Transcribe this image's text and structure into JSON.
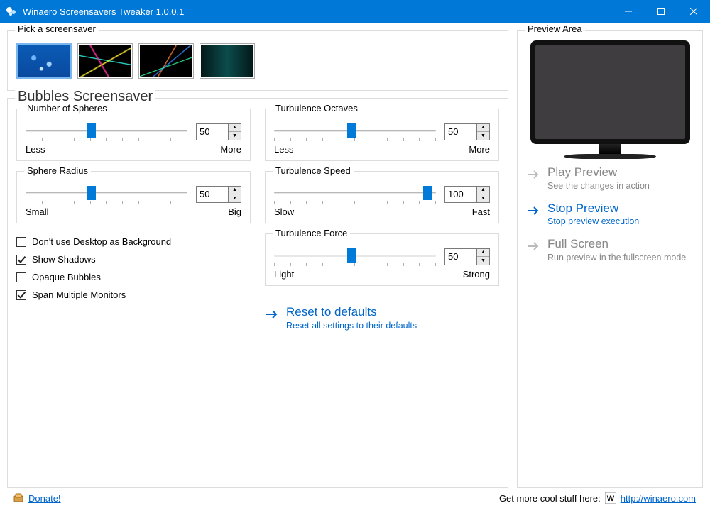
{
  "window": {
    "title": "Winaero Screensavers Tweaker 1.0.0.1"
  },
  "screensaverPicker": {
    "heading": "Pick a screensaver",
    "selected_index": 0
  },
  "settingsPanel": {
    "heading": "Bubbles Screensaver"
  },
  "sliders": {
    "spheres": {
      "label": "Number of Spheres",
      "value": "50",
      "pos": 38,
      "min_label": "Less",
      "max_label": "More"
    },
    "radius": {
      "label": "Sphere Radius",
      "value": "50",
      "pos": 38,
      "min_label": "Small",
      "max_label": "Big"
    },
    "octaves": {
      "label": "Turbulence Octaves",
      "value": "50",
      "pos": 45,
      "min_label": "Less",
      "max_label": "More"
    },
    "speed": {
      "label": "Turbulence Speed",
      "value": "100",
      "pos": 92,
      "min_label": "Slow",
      "max_label": "Fast"
    },
    "force": {
      "label": "Turbulence Force",
      "value": "50",
      "pos": 45,
      "min_label": "Light",
      "max_label": "Strong"
    }
  },
  "checks": {
    "desktop_bg": {
      "label": "Don't use Desktop as Background",
      "checked": false
    },
    "shadows": {
      "label": "Show Shadows",
      "checked": true
    },
    "opaque": {
      "label": "Opaque Bubbles",
      "checked": false
    },
    "span": {
      "label": "Span Multiple Monitors",
      "checked": true
    }
  },
  "reset": {
    "title": "Reset to defaults",
    "sub": "Reset all settings to their defaults"
  },
  "preview": {
    "heading": "Preview Area",
    "play": {
      "title": "Play Preview",
      "sub": "See the changes in action"
    },
    "stop": {
      "title": "Stop Preview",
      "sub": "Stop preview execution"
    },
    "full": {
      "title": "Full Screen",
      "sub": "Run preview in the fullscreen mode"
    }
  },
  "footer": {
    "donate": "Donate!",
    "blurb": "Get more cool stuff here:",
    "url": "http://winaero.com"
  }
}
